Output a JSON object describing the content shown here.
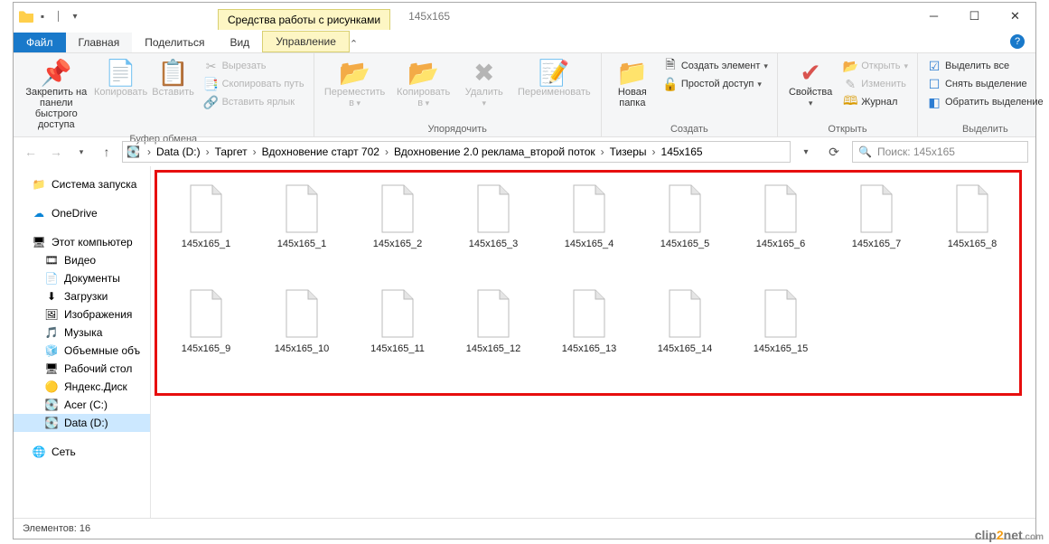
{
  "titlebar": {
    "context_tab": "Средства работы с рисунками",
    "title": "145x165"
  },
  "tabs": {
    "file": "Файл",
    "home": "Главная",
    "share": "Поделиться",
    "view": "Вид",
    "manage": "Управление"
  },
  "ribbon": {
    "clipboard": {
      "pin": "Закрепить на панели\nбыстрого доступа",
      "copy": "Копировать",
      "paste": "Вставить",
      "cut": "Вырезать",
      "copy_path": "Скопировать путь",
      "paste_shortcut": "Вставить ярлык",
      "group": "Буфер обмена"
    },
    "organize": {
      "move_to": "Переместить\nв",
      "copy_to": "Копировать\nв",
      "delete": "Удалить",
      "rename": "Переименовать",
      "group": "Упорядочить"
    },
    "new": {
      "new_folder": "Новая\nпапка",
      "new_item": "Создать элемент",
      "easy_access": "Простой доступ",
      "group": "Создать"
    },
    "open": {
      "properties": "Свойства",
      "open": "Открыть",
      "edit": "Изменить",
      "history": "Журнал",
      "group": "Открыть"
    },
    "select": {
      "select_all": "Выделить все",
      "select_none": "Снять выделение",
      "invert": "Обратить выделение",
      "group": "Выделить"
    }
  },
  "breadcrumb": {
    "items": [
      "Data (D:)",
      "Таргет",
      "Вдохновение старт 702",
      "Вдохновение 2.0 реклама_второй поток",
      "Тизеры",
      "145х165"
    ]
  },
  "search": {
    "placeholder": "Поиск: 145x165"
  },
  "tree": {
    "items": [
      {
        "icon": "📁",
        "label": "Система запуска",
        "indent": 0
      },
      {
        "sep": true
      },
      {
        "icon": "☁",
        "label": "OneDrive",
        "color": "#0a84d6",
        "indent": 0
      },
      {
        "sep": true
      },
      {
        "icon": "🖥",
        "label": "Этот компьютер",
        "indent": 0
      },
      {
        "icon": "🎞",
        "label": "Видео",
        "indent": 1
      },
      {
        "icon": "📄",
        "label": "Документы",
        "indent": 1
      },
      {
        "icon": "⬇",
        "label": "Загрузки",
        "indent": 1
      },
      {
        "icon": "🖼",
        "label": "Изображения",
        "indent": 1
      },
      {
        "icon": "🎵",
        "label": "Музыка",
        "indent": 1
      },
      {
        "icon": "🧊",
        "label": "Объемные объ",
        "indent": 1
      },
      {
        "icon": "🖥",
        "label": "Рабочий стол",
        "indent": 1
      },
      {
        "icon": "🟡",
        "label": "Яндекс.Диск",
        "indent": 1
      },
      {
        "icon": "💽",
        "label": "Acer (C:)",
        "indent": 1
      },
      {
        "icon": "💽",
        "label": "Data (D:)",
        "indent": 1,
        "selected": true
      },
      {
        "sep": true
      },
      {
        "icon": "🌐",
        "label": "Сеть",
        "indent": 0
      }
    ]
  },
  "files": [
    {
      "name": "145x165_1"
    },
    {
      "name": "145x165_1"
    },
    {
      "name": "145x165_2"
    },
    {
      "name": "145x165_3"
    },
    {
      "name": "145x165_4"
    },
    {
      "name": "145x165_5"
    },
    {
      "name": "145x165_6"
    },
    {
      "name": "145x165_7"
    },
    {
      "name": "145x165_8"
    },
    {
      "name": "145x165_9"
    },
    {
      "name": "145x165_10"
    },
    {
      "name": "145x165_11"
    },
    {
      "name": "145x165_12"
    },
    {
      "name": "145x165_13"
    },
    {
      "name": "145x165_14"
    },
    {
      "name": "145x165_15"
    }
  ],
  "statusbar": {
    "elements": "Элементов: 16"
  },
  "watermark": {
    "a": "clip",
    "b": "2",
    "c": "net",
    "d": ".com"
  }
}
